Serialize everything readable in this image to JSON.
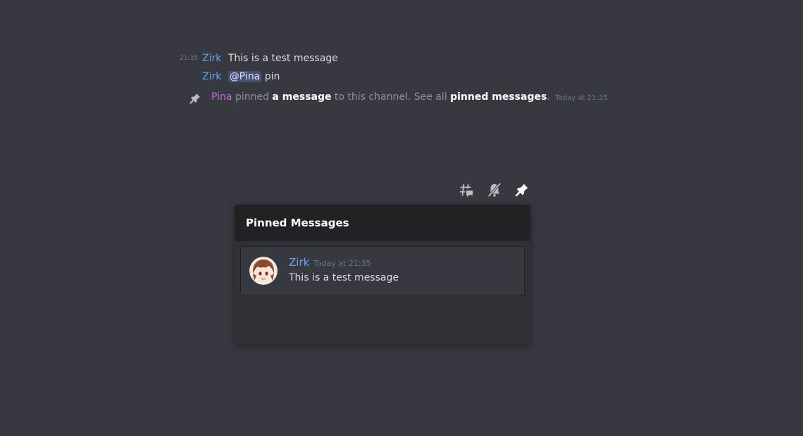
{
  "messages": [
    {
      "timestamp": "21:35",
      "author": "Zirk",
      "text": "This is a test message"
    },
    {
      "author": "Zirk",
      "mention": "@Pina",
      "text": "pin"
    }
  ],
  "system_message": {
    "icon": "pin-icon",
    "user": "Pina",
    "part1": "pinned",
    "link1": "a message",
    "part2": "to this channel. See all",
    "link2": "pinned messages",
    "end": ".",
    "time": "Today at 21:35"
  },
  "toolbar": {
    "icons": [
      "threads-icon",
      "notifications-muted-icon",
      "pinned-messages-icon"
    ]
  },
  "pinned_popout": {
    "title": "Pinned Messages",
    "items": [
      {
        "author": "Zirk",
        "time": "Today at 21:35",
        "text": "This is a test message"
      }
    ]
  },
  "colors": {
    "background": "#36393f",
    "author_blue": "#6ba1f0",
    "author_purple": "#c06bd3",
    "popout_header": "#202225"
  }
}
